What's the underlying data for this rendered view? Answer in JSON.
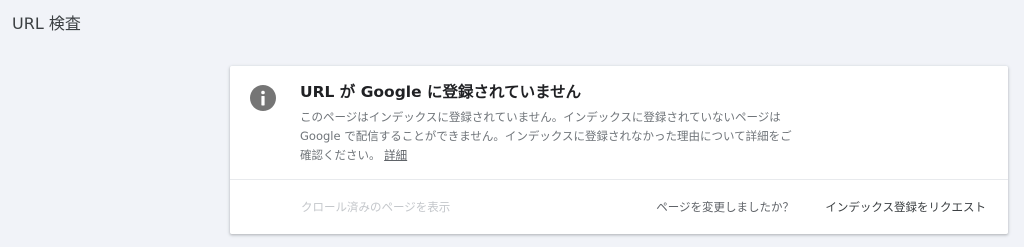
{
  "page": {
    "title": "URL 検査"
  },
  "result": {
    "headline": "URL が Google に登録されていません",
    "description": "このページはインデックスに登録されていません。インデックスに登録されていないページは Google で配信することができません。インデックスに登録されなかった理由について詳細をご確認ください。",
    "details_link": "詳細",
    "icon": "info-icon"
  },
  "actions": {
    "view_crawled_page": "クロール済みのページを表示",
    "page_changed": "ページを変更しましたか？",
    "request_indexing": "インデックス登録をリクエスト"
  },
  "colors": {
    "background": "#f1f3f8",
    "icon": "#757575",
    "disabled_text": "#c4c7cb"
  }
}
